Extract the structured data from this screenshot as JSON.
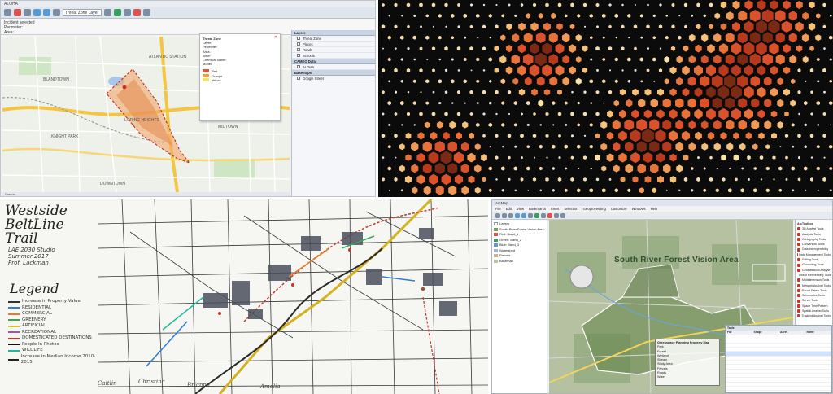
{
  "panel1": {
    "window_title": "ALOHA",
    "toolbar": {
      "select_value": "Threat Zone Layer"
    },
    "info_lines": [
      "Incident selected",
      "Perimeter:",
      "Area:"
    ],
    "popup": {
      "title": "Threat Zone",
      "layer_label": "Layer:",
      "perimeter_label": "Perimeter:",
      "area_label": "Area:",
      "time_label": "Time:",
      "chemical_label": "Chemical Name:",
      "model_label": "Model:",
      "rows": [
        {
          "label": "Red",
          "color": "#e0503c"
        },
        {
          "label": "Orange",
          "color": "#f0a040"
        },
        {
          "label": "Yellow",
          "color": "#f4e36a"
        }
      ]
    },
    "sidebar": {
      "sections": [
        {
          "title": "Layers",
          "items": [
            "Threat Zone",
            "Places",
            "Roads",
            "Schools"
          ]
        },
        {
          "title": "CAMEO Data",
          "items": [
            "ALOHA"
          ]
        },
        {
          "title": "Basemaps",
          "items": [
            "Google Street"
          ]
        }
      ]
    },
    "map_labels": [
      "BLANDTOWN",
      "ATLANTIC STATION",
      "MIDTOWN",
      "KNIGHT PARK",
      "LORING HEIGHTS",
      "DOWNTOWN"
    ],
    "status_text": "Cursor:"
  },
  "panel3": {
    "title_lines": [
      "Westside",
      "BeltLine",
      "Trail"
    ],
    "subtitle_lines": [
      "LAE 2030 Studio",
      "Summer 2017",
      "Prof. Lackman"
    ],
    "legend_title": "Legend",
    "legend_items": [
      {
        "label": "Increase in Property Value",
        "color": "#333333"
      },
      {
        "label": "RESIDENTIAL",
        "color": "#2e7cd6"
      },
      {
        "label": "COMMERCIAL",
        "color": "#e87a2a"
      },
      {
        "label": "GREENERY",
        "color": "#3aa655"
      },
      {
        "label": "ARTIFICIAL",
        "color": "#d6c22e"
      },
      {
        "label": "RECREATIONAL",
        "color": "#9b59b6"
      },
      {
        "label": "DOMESTICATED DESTINATIONS",
        "color": "#c0392b"
      },
      {
        "label": "People In Photos",
        "color": "#111111"
      },
      {
        "label": "WILDLIFE",
        "color": "#1abc9c"
      },
      {
        "label": "Increase in Median Income 2010-2015",
        "color": "#222222"
      }
    ],
    "signatures": [
      "Caitlin",
      "Christina",
      "Brianna",
      "Amelia"
    ]
  },
  "panel4": {
    "window_title": "ArcMap",
    "menu": [
      "File",
      "Edit",
      "View",
      "Bookmarks",
      "Insert",
      "Selection",
      "Geoprocessing",
      "Customize",
      "Windows",
      "Help"
    ],
    "toc_items": [
      {
        "label": "Layers",
        "color": "#ffffff"
      },
      {
        "label": "South River Forest Vision Area",
        "color": "#7a9a55"
      },
      {
        "label": "Red: Band_1",
        "color": "#d9534f"
      },
      {
        "label": "Green: Band_2",
        "color": "#3a9d5d"
      },
      {
        "label": "Blue: Band_3",
        "color": "#5b9bd5"
      },
      {
        "label": "Watershed",
        "color": "#9ab7d3"
      },
      {
        "label": "Parcels",
        "color": "#c9b38a"
      },
      {
        "label": "Basemap",
        "color": "#b8c4a6"
      }
    ],
    "map_title": "South River Forest Vision Area",
    "legend_title": "Greenspace Planning Property Map",
    "legend_items": [
      "Park",
      "Forest",
      "Wetland",
      "Stream",
      "Study Area",
      "Parcels",
      "Roads",
      "Water"
    ],
    "toolbox_title": "ArcToolbox",
    "toolbox_items": [
      "3D Analyst Tools",
      "Analysis Tools",
      "Cartography Tools",
      "Conversion Tools",
      "Data Interoperability",
      "Data Management Tools",
      "Editing Tools",
      "Geocoding Tools",
      "Geostatistical Analyst",
      "Linear Referencing Tools",
      "Multidimension Tools",
      "Network Analyst Tools",
      "Parcel Fabric Tools",
      "Schematics Tools",
      "Server Tools",
      "Space Time Pattern",
      "Spatial Analyst Tools",
      "Tracking Analyst Tools"
    ],
    "table": {
      "title": "Table",
      "columns": [
        "FID",
        "Shape",
        "Acres",
        "Name"
      ],
      "row_count": 14
    }
  },
  "hexbin": {
    "colors": [
      "#2a1a0a",
      "#7a2a12",
      "#b8391c",
      "#d9522b",
      "#e8733a",
      "#f19a55",
      "#f6c27a",
      "#fbe3a6"
    ]
  }
}
